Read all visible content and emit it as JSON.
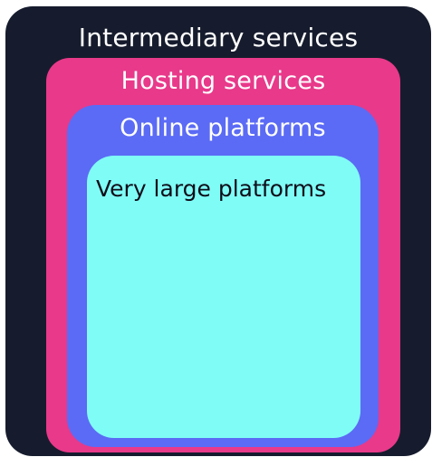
{
  "diagram": {
    "layers": {
      "intermediary": {
        "label": "Intermediary services",
        "fill": "#161c2d",
        "text_color": "#ffffff"
      },
      "hosting": {
        "label": "Hosting services",
        "fill": "#e8398a",
        "text_color": "#ffffff"
      },
      "online": {
        "label": "Online platforms",
        "fill": "#5b6bf5",
        "text_color": "#ffffff"
      },
      "vlop": {
        "label": "Very large platforms",
        "fill": "#80fcf6",
        "text_color": "#0d0e1a"
      }
    }
  }
}
